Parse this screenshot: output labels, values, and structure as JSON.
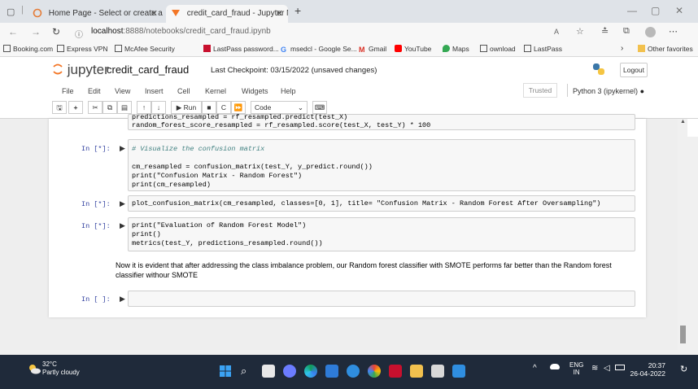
{
  "browser": {
    "tabs": [
      {
        "label": "Home Page - Select or create a n",
        "active": false
      },
      {
        "label": "credit_card_fraud - Jupyter Note",
        "active": true
      }
    ],
    "new_tab": "+",
    "url_host": "localhost",
    "url_path": ":8888/notebooks/credit_card_fraud.ipynb",
    "bookmarks": [
      "Booking.com",
      "Express VPN",
      "McAfee Security",
      "LastPass password...",
      "msedcl - Google Se...",
      "Gmail",
      "YouTube",
      "Maps",
      "ownload",
      "LastPass"
    ],
    "other_favorites": "Other favorites"
  },
  "jupyter": {
    "logo": "jupyter",
    "notebook_name": "credit_card_fraud",
    "checkpoint": "Last Checkpoint: 03/15/2022  (unsaved changes)",
    "logout": "Logout",
    "menu": [
      "File",
      "Edit",
      "View",
      "Insert",
      "Cell",
      "Kernel",
      "Widgets",
      "Help"
    ],
    "trusted": "Trusted",
    "kernel": "Python 3 (ipykernel)",
    "toolbar": {
      "run": "Run",
      "celltype": "Code"
    }
  },
  "cells": [
    {
      "prompt": "",
      "lines": [
        "predictions_resampled = rf_resampled.predict(test_X)",
        "random_forest_score_resampled = rf_resampled.score(test_X, test_Y) * 100"
      ]
    },
    {
      "prompt": "In [*]:",
      "lines": [
        "# Visualize the confusion matrix",
        "",
        "cm_resampled = confusion_matrix(test_Y, y_predict.round())",
        "print(\"Confusion Matrix - Random Forest\")",
        "print(cm_resampled)"
      ]
    },
    {
      "prompt": "In [*]:",
      "lines": [
        "plot_confusion_matrix(cm_resampled, classes=[0, 1], title= \"Confusion Matrix - Random Forest After Oversampling\")"
      ]
    },
    {
      "prompt": "In [*]:",
      "lines": [
        "print(\"Evaluation of Random Forest Model\")",
        "print()",
        "metrics(test_Y, predictions_resampled.round())"
      ]
    },
    {
      "prompt": "In [ ]:",
      "lines": [
        ""
      ]
    }
  ],
  "markdown": "Now it is evident that after addressing the class imbalance problem, our Random forest classifier with SMOTE performs far better than the Random forest classifier withour SMOTE",
  "taskbar": {
    "temp": "32°C",
    "weather": "Partly cloudy",
    "lang": "ENG",
    "region": "IN",
    "time": "20:37",
    "date": "26-04-2022"
  }
}
